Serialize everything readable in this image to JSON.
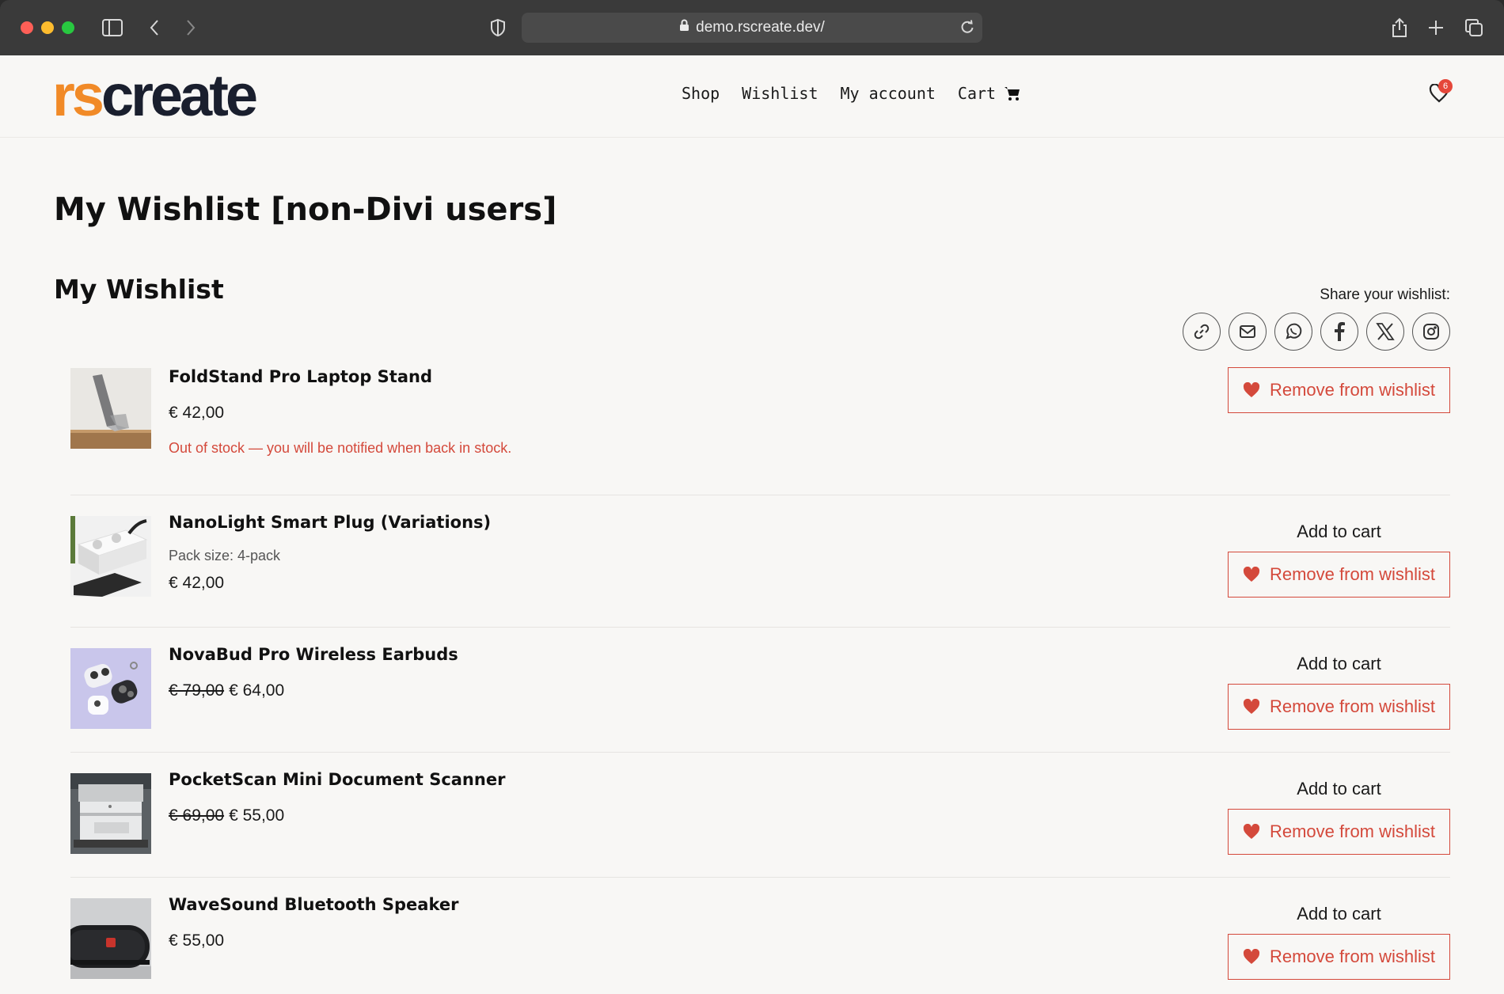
{
  "browser": {
    "url": "demo.rscreate.dev/"
  },
  "header": {
    "logo_part1": "rs",
    "logo_part2": "create",
    "nav": [
      "Shop",
      "Wishlist",
      "My account",
      "Cart"
    ],
    "wishlist_count": "6"
  },
  "page": {
    "title": "My Wishlist [non-Divi users]",
    "section_title": "My Wishlist",
    "share_label": "Share your wishlist:",
    "share_icons": [
      "link-icon",
      "email-icon",
      "whatsapp-icon",
      "facebook-icon",
      "x-icon",
      "instagram-icon"
    ]
  },
  "items": [
    {
      "name": "FoldStand Pro Laptop Stand",
      "price": "€ 42,00",
      "stock_note": "Out of stock — you will be notified when back in stock.",
      "remove_label": "Remove from wishlist"
    },
    {
      "name": "NanoLight Smart Plug (Variations)",
      "meta": "Pack size: 4-pack",
      "price": "€ 42,00",
      "add_label": "Add to cart",
      "remove_label": "Remove from wishlist"
    },
    {
      "name": "NovaBud Pro Wireless Earbuds",
      "old_price": "€ 79,00",
      "price": "€ 64,00",
      "add_label": "Add to cart",
      "remove_label": "Remove from wishlist"
    },
    {
      "name": "PocketScan Mini Document Scanner",
      "old_price": "€ 69,00",
      "price": "€ 55,00",
      "add_label": "Add to cart",
      "remove_label": "Remove from wishlist"
    },
    {
      "name": "WaveSound Bluetooth Speaker",
      "price": "€ 55,00",
      "add_label": "Add to cart",
      "remove_label": "Remove from wishlist"
    }
  ],
  "colors": {
    "accent": "#d4493b",
    "brand_orange": "#f18a27",
    "brand_dark": "#1a1f2e"
  }
}
